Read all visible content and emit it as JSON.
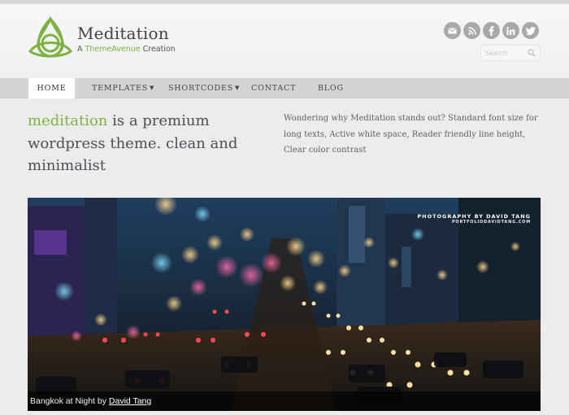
{
  "header": {
    "site_title": "Meditation",
    "tagline_prefix": "A ",
    "tagline_brand": "ThemeAvenue",
    "tagline_suffix": " Creation",
    "brand_color": "#7cb342",
    "social_icons": [
      "email-icon",
      "rss-icon",
      "facebook-icon",
      "linkedin-icon",
      "twitter-icon"
    ]
  },
  "search": {
    "placeholder": "Search"
  },
  "nav": {
    "items": [
      {
        "label": "Home",
        "active": true
      },
      {
        "label": "Templates",
        "dropdown": true
      },
      {
        "label": "Shortcodes",
        "dropdown": true
      },
      {
        "label": "Contact"
      },
      {
        "label": "Blog"
      }
    ]
  },
  "intro": {
    "accent": "meditation",
    "rest": " is a premium wordpress theme. clean and minimalist"
  },
  "blurb": "Wondering why Meditation stands out? Standard font size for long texts, Active white space, Reader friendly line height, Clear color contrast",
  "slider": {
    "credit_line1": "PHOTOGRAPHY BY DAVID TANG",
    "credit_line2": "PORTFOLIODAVIDTANG.COM",
    "caption_text": "Bangkok at Night by ",
    "caption_link": "David Tang"
  }
}
